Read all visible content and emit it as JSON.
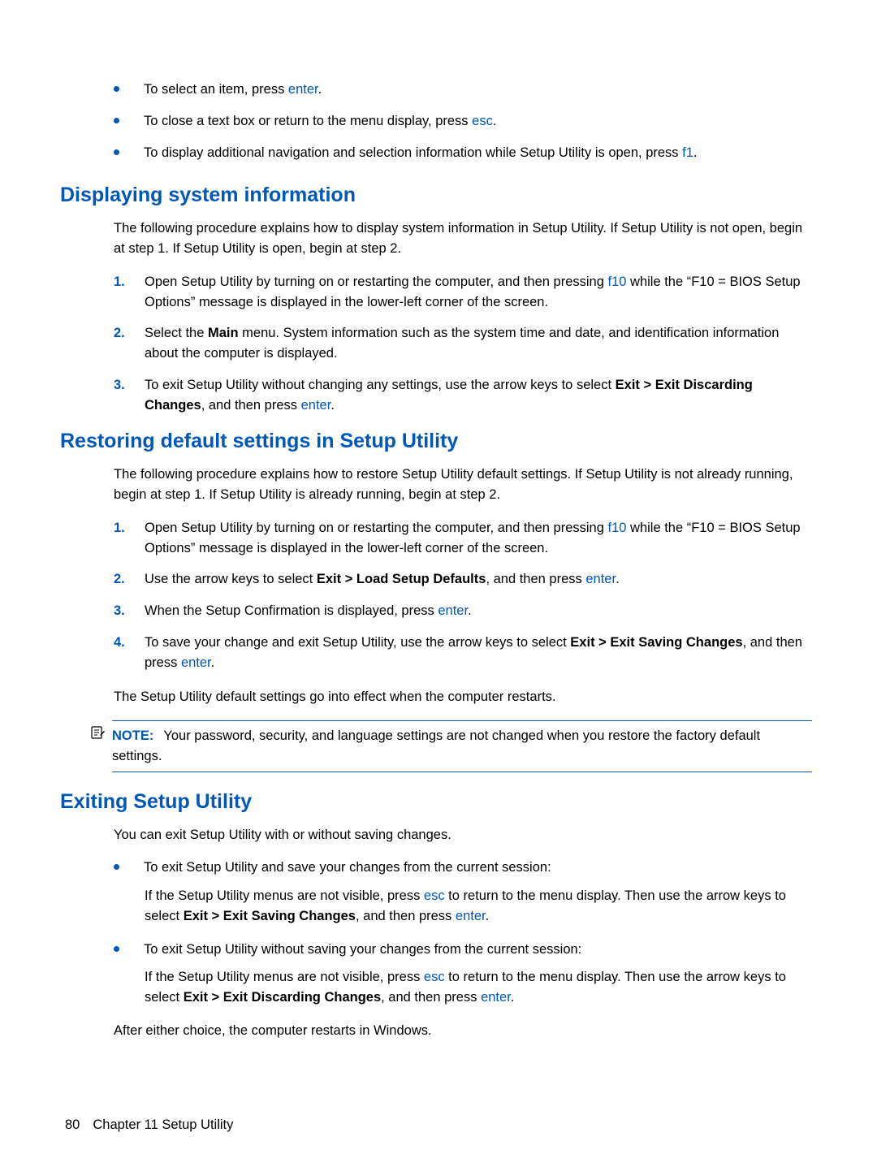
{
  "topBullets": {
    "b1_pre": "To select an item, press ",
    "b1_key": "enter",
    "b1_post": ".",
    "b2_pre": "To close a text box or return to the menu display, press ",
    "b2_key": "esc",
    "b2_post": ".",
    "b3_pre": "To display additional navigation and selection information while Setup Utility is open, press ",
    "b3_key": "f1",
    "b3_post": "."
  },
  "section1": {
    "heading": "Displaying system information",
    "intro": "The following procedure explains how to display system information in Setup Utility. If Setup Utility is not open, begin at step 1. If Setup Utility is open, begin at step 2.",
    "step1_num": "1.",
    "step1_pre": "Open Setup Utility by turning on or restarting the computer, and then pressing ",
    "step1_key": "f10",
    "step1_post": " while the “F10 = BIOS Setup Options” message is displayed in the lower-left corner of the screen.",
    "step2_num": "2.",
    "step2_a": "Select the ",
    "step2_bold": "Main",
    "step2_b": " menu. System information such as the system time and date, and identification information about the computer is displayed.",
    "step3_num": "3.",
    "step3_a": "To exit Setup Utility without changing any settings, use the arrow keys to select ",
    "step3_bold": "Exit > Exit Discarding Changes",
    "step3_b": ", and then press ",
    "step3_key": "enter",
    "step3_c": "."
  },
  "section2": {
    "heading": "Restoring default settings in Setup Utility",
    "intro": "The following procedure explains how to restore Setup Utility default settings. If Setup Utility is not already running, begin at step 1. If Setup Utility is already running, begin at step 2.",
    "step1_num": "1.",
    "step1_pre": "Open Setup Utility by turning on or restarting the computer, and then pressing ",
    "step1_key": "f10",
    "step1_post": " while the “F10 = BIOS Setup Options” message is displayed in the lower-left corner of the screen.",
    "step2_num": "2.",
    "step2_a": "Use the arrow keys to select ",
    "step2_bold": "Exit > Load Setup Defaults",
    "step2_b": ", and then press ",
    "step2_key": "enter",
    "step2_c": ".",
    "step3_num": "3.",
    "step3_a": "When the Setup Confirmation is displayed, press ",
    "step3_key": "enter",
    "step3_b": ".",
    "step4_num": "4.",
    "step4_a": "To save your change and exit Setup Utility, use the arrow keys to select ",
    "step4_bold": "Exit > Exit Saving Changes",
    "step4_b": ", and then press ",
    "step4_key": "enter",
    "step4_c": ".",
    "para2": "The Setup Utility default settings go into effect when the computer restarts.",
    "noteLabel": "NOTE:",
    "noteText": "Your password, security, and language settings are not changed when you restore the factory default settings."
  },
  "section3": {
    "heading": "Exiting Setup Utility",
    "intro": "You can exit Setup Utility with or without saving changes.",
    "b1": "To exit Setup Utility and save your changes from the current session:",
    "b1_sub_a": "If the Setup Utility menus are not visible, press ",
    "b1_sub_key1": "esc",
    "b1_sub_b": " to return to the menu display. Then use the arrow keys to select ",
    "b1_sub_bold": "Exit > Exit Saving Changes",
    "b1_sub_c": ", and then press ",
    "b1_sub_key2": "enter",
    "b1_sub_d": ".",
    "b2": "To exit Setup Utility without saving your changes from the current session:",
    "b2_sub_a": "If the Setup Utility menus are not visible, press ",
    "b2_sub_key1": "esc",
    "b2_sub_b": " to return to the menu display. Then use the arrow keys to select ",
    "b2_sub_bold": "Exit > Exit Discarding Changes",
    "b2_sub_c": ", and then press ",
    "b2_sub_key2": "enter",
    "b2_sub_d": ".",
    "outro": "After either choice, the computer restarts in Windows."
  },
  "footer": {
    "pagenum": "80",
    "chapter": "Chapter 11   Setup Utility"
  }
}
